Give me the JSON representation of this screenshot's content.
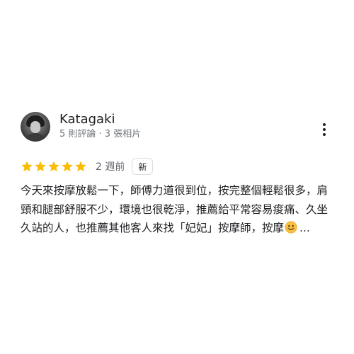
{
  "review": {
    "reviewer_name": "Katagaki",
    "reviewer_meta": "5 則評論 · 3 張相片",
    "rating": 5,
    "max_rating": 5,
    "date": "2 週前",
    "badge": "新",
    "text": "今天來按摩放鬆一下，師傅力道很到位，按完整個輕鬆很多，肩頸和腿部舒服不少，環境也很乾淨，推薦給平常容易痠痛、久坐久站的人，也推薦其他客人來找「妃妃」按摩師，按摩",
    "emoji": "smiling-face-icon",
    "more_label": "..."
  },
  "colors": {
    "star": "#fbbc04",
    "text": "#202124",
    "meta": "#70757a"
  },
  "icons": {
    "menu": "more-vert-icon",
    "star": "star-icon"
  }
}
